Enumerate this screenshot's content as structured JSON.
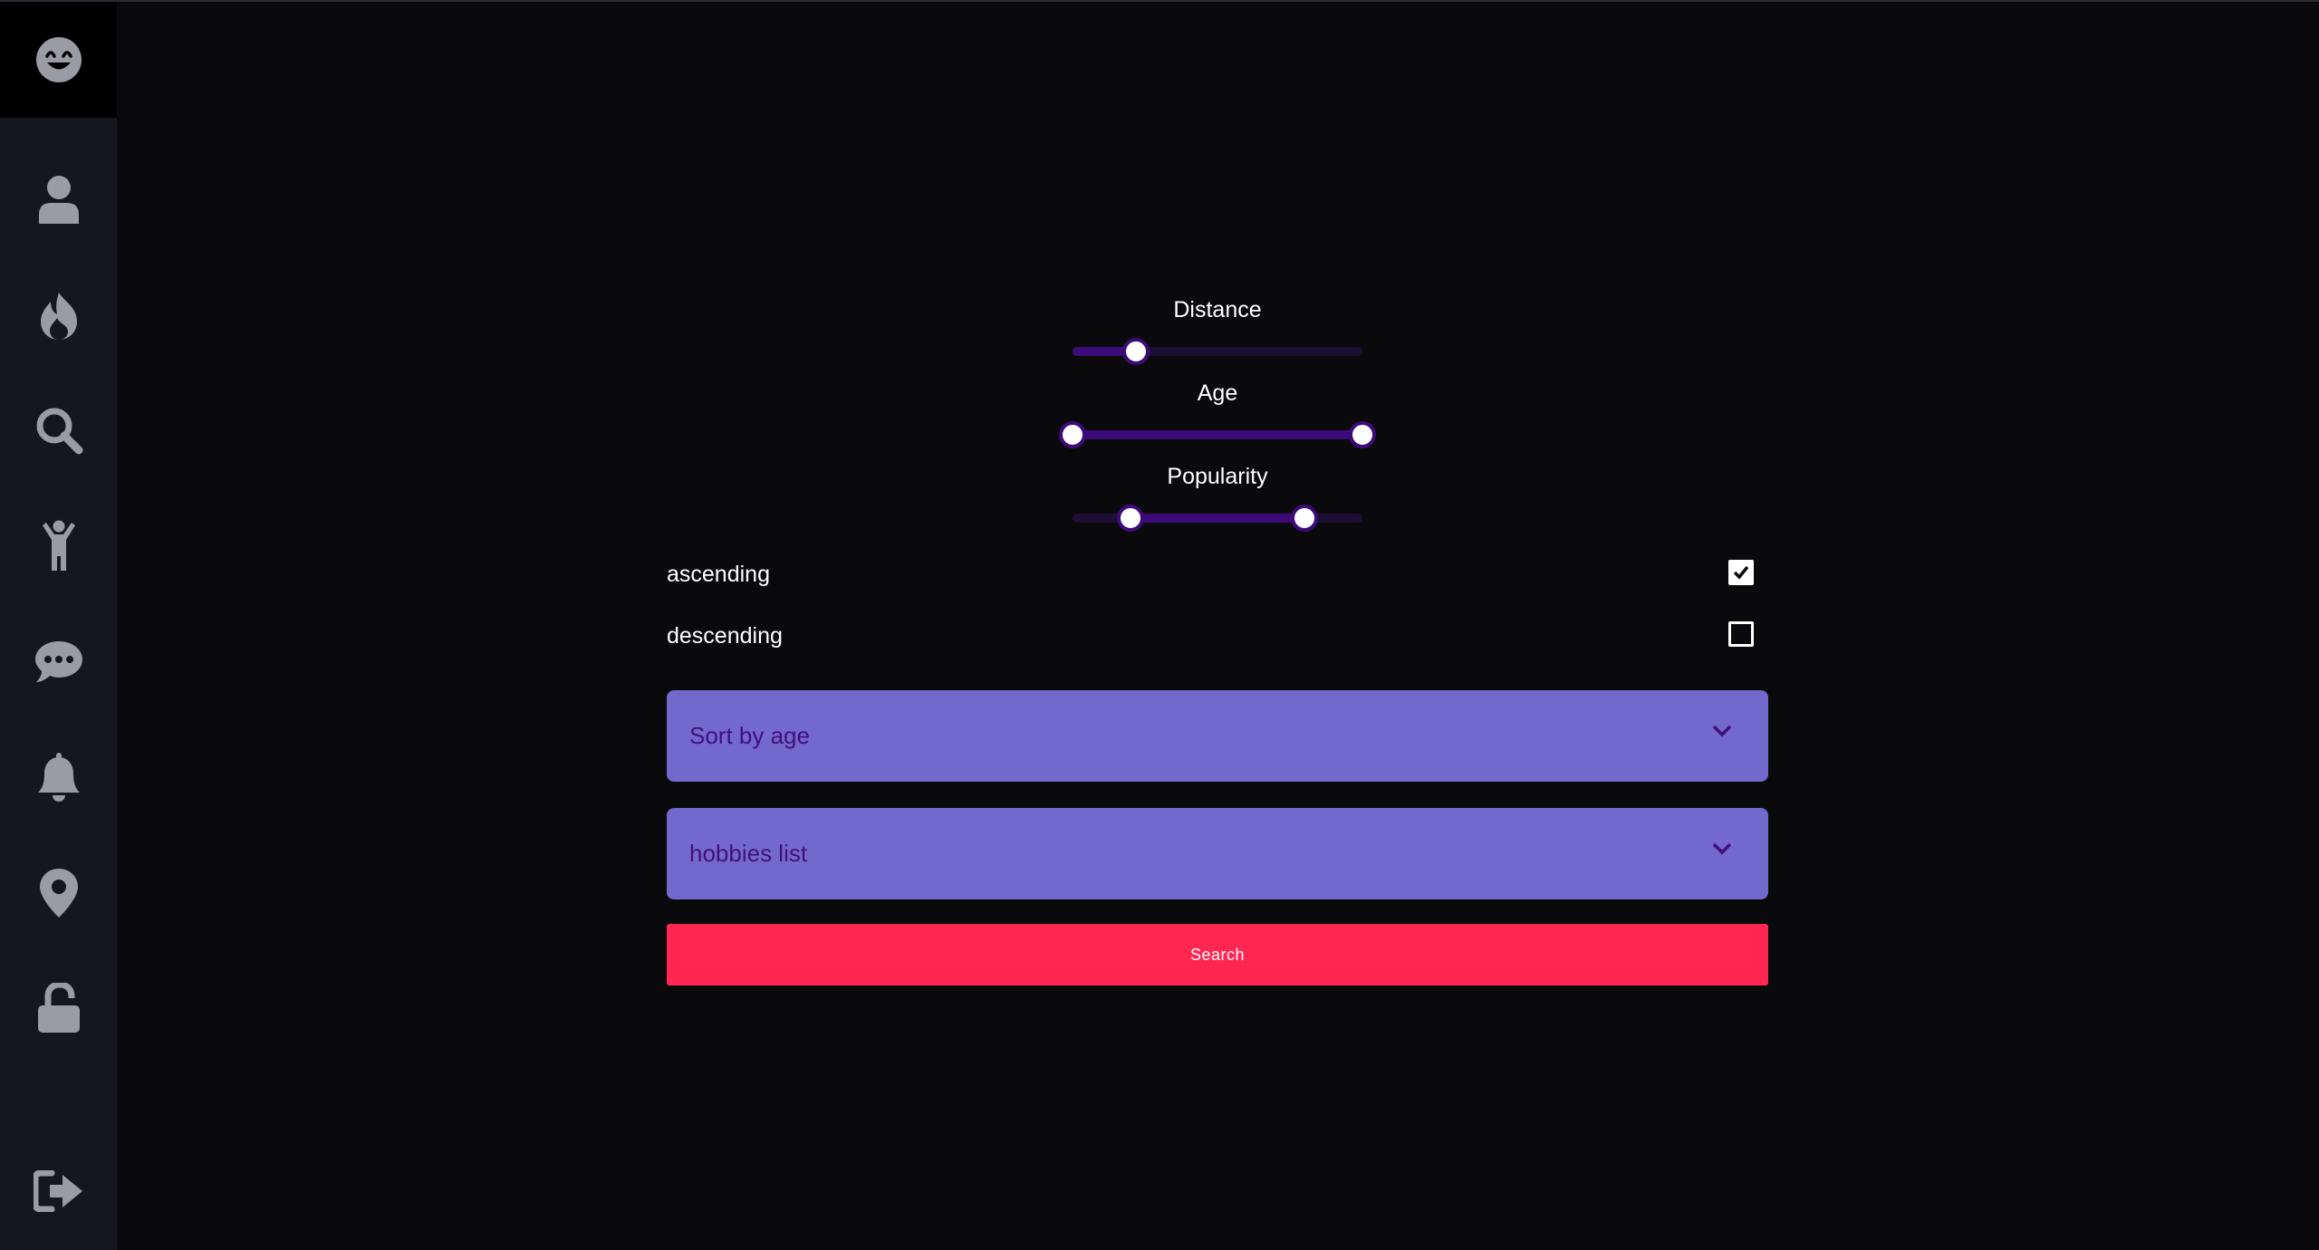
{
  "sidebar": {
    "logo_icon": "smiling-face-icon",
    "items": [
      {
        "name": "profile",
        "icon": "user-icon"
      },
      {
        "name": "matches",
        "icon": "fire-icon"
      },
      {
        "name": "search",
        "icon": "search-icon"
      },
      {
        "name": "visitors",
        "icon": "child-icon"
      },
      {
        "name": "chat",
        "icon": "comment-dots-icon"
      },
      {
        "name": "notifications",
        "icon": "bell-icon"
      },
      {
        "name": "location",
        "icon": "map-marker-icon"
      },
      {
        "name": "password",
        "icon": "unlock-icon"
      }
    ],
    "logout_icon": "sign-out-icon"
  },
  "filters": {
    "distance": {
      "label": "Distance",
      "value_fraction": 0.22
    },
    "age": {
      "label": "Age",
      "range_fraction": [
        0.0,
        1.0
      ]
    },
    "popularity": {
      "label": "Popularity",
      "range_fraction": [
        0.2,
        0.8
      ]
    }
  },
  "order": {
    "ascending": {
      "label": "ascending",
      "checked": true
    },
    "descending": {
      "label": "descending",
      "checked": false
    }
  },
  "sort_select": {
    "value": "Sort by age"
  },
  "hobbies_select": {
    "value": "hobbies list"
  },
  "search_button": {
    "label": "Search"
  },
  "colors": {
    "accent": "#3d0a79",
    "select_bg": "#7369cc",
    "button": "#ff2652",
    "sidebar_bg": "#15161e"
  }
}
